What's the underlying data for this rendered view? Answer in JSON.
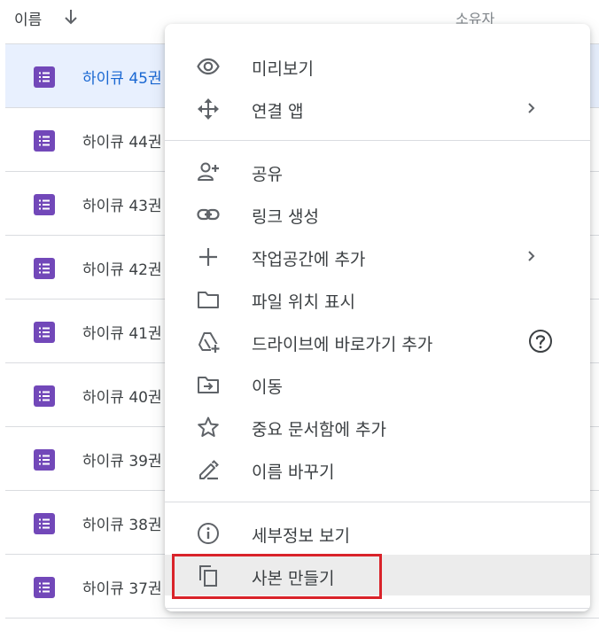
{
  "header": {
    "name_label": "이름",
    "owner_label": "소유자"
  },
  "files": [
    {
      "name": "하이큐 45권",
      "selected": true
    },
    {
      "name": "하이큐 44권",
      "selected": false
    },
    {
      "name": "하이큐 43권",
      "selected": false
    },
    {
      "name": "하이큐 42권",
      "selected": false
    },
    {
      "name": "하이큐 41권",
      "selected": false
    },
    {
      "name": "하이큐 40권",
      "selected": false
    },
    {
      "name": "하이큐 39권",
      "selected": false
    },
    {
      "name": "하이큐 38권",
      "selected": false
    },
    {
      "name": "하이큐 37권",
      "selected": false
    }
  ],
  "menu": {
    "preview": "미리보기",
    "open_with": "연결 앱",
    "share": "공유",
    "get_link": "링크 생성",
    "add_workspace": "작업공간에 추가",
    "show_location": "파일 위치 표시",
    "add_shortcut": "드라이브에 바로가기 추가",
    "move": "이동",
    "add_starred": "중요 문서함에 추가",
    "rename": "이름 바꾸기",
    "view_details": "세부정보 보기",
    "make_copy": "사본 만들기"
  },
  "colors": {
    "forms_icon": "#7248b9",
    "selected_row": "#e8f0fe",
    "highlight_box": "#d9232a"
  }
}
